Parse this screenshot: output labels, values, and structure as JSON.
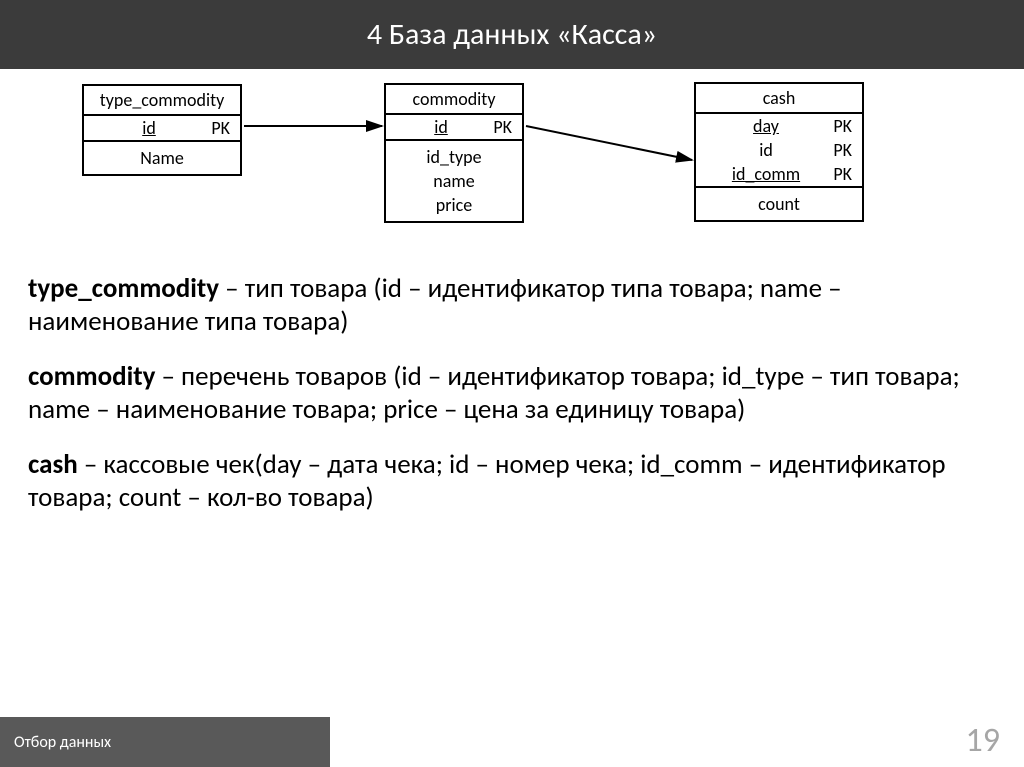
{
  "title": "4  База данных «Касса»",
  "tables": {
    "t1": {
      "name": "type_commodity",
      "keys": [
        {
          "field": "id",
          "key": "PK",
          "underline": true
        }
      ],
      "attrs": [
        "Name"
      ]
    },
    "t2": {
      "name": "commodity",
      "keys": [
        {
          "field": "id",
          "key": "PK",
          "underline": true
        }
      ],
      "attrs": [
        "id_type",
        "name",
        "price"
      ]
    },
    "t3": {
      "name": "cash",
      "keys": [
        {
          "field": "day",
          "key": "PK",
          "underline": true
        },
        {
          "field": "id",
          "key": "PK",
          "underline": false
        },
        {
          "field": "id_comm",
          "key": "PK",
          "underline": true
        }
      ],
      "attrs": [
        "count"
      ]
    }
  },
  "descriptions": {
    "d1": {
      "term": "type_commodity",
      "text": " – тип товара (id – идентификатор типа товара; name – наименование типа товара)"
    },
    "d2": {
      "term": "commodity",
      "text": " – перечень товаров (id – идентификатор товара; id_type – тип товара; name – наименование товара; price – цена за единицу товара)"
    },
    "d3": {
      "term": "cash",
      "text": " – кассовые чек(day – дата чека; id – номер чека; id_comm – идентификатор товара; count – кол-во товара)"
    }
  },
  "footer": {
    "label": "Отбор данных",
    "page": "19"
  },
  "chart_data": {
    "type": "table",
    "title": "База данных «Касса» — ER-диаграмма",
    "entities": [
      {
        "name": "type_commodity",
        "primary_key": [
          "id"
        ],
        "attributes": [
          "Name"
        ]
      },
      {
        "name": "commodity",
        "primary_key": [
          "id"
        ],
        "attributes": [
          "id_type",
          "name",
          "price"
        ]
      },
      {
        "name": "cash",
        "primary_key": [
          "day",
          "id",
          "id_comm"
        ],
        "attributes": [
          "count"
        ]
      }
    ],
    "relations": [
      {
        "from": "type_commodity.id",
        "to": "commodity.id_type"
      },
      {
        "from": "commodity.id",
        "to": "cash.id_comm"
      }
    ]
  }
}
